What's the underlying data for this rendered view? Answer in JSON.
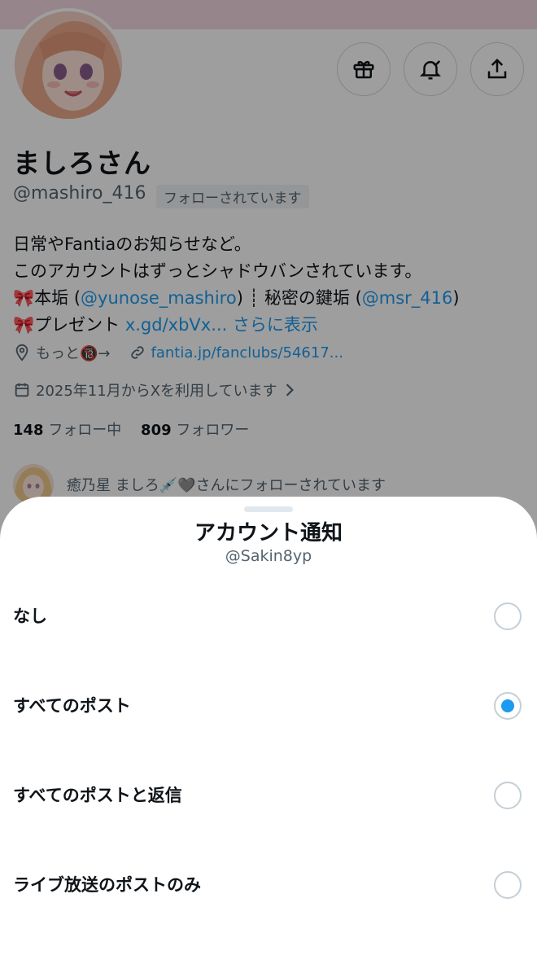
{
  "profile": {
    "name": "ましろさん",
    "handle": "@mashiro_416",
    "follows_you": "フォローされています",
    "bio": {
      "line1": "日常やFantiaのお知らせなど。",
      "line2": "このアカウントはずっとシャドウバンされています。",
      "line3_prefix": "🎀本垢 (",
      "line3_link1": "@yunose_mashiro",
      "line3_mid": ") ┊ 秘密の鍵垢 (",
      "line3_link2": "@msr_416",
      "line3_suffix": ")",
      "line4_prefix": "🎀プレゼント ",
      "line4_link": "x.gd/xbVx...",
      "line4_more": "さらに表示"
    },
    "location": "もっと🔞→",
    "website": "fantia.jp/fanclubs/54617...",
    "joined": "2025年11月からXを利用しています",
    "following_count": "148",
    "following_label": "フォロー中",
    "followers_count": "809",
    "followers_label": "フォロワー",
    "mutual_text": "癒乃星 ましろ💉🩶さんにフォローされています"
  },
  "header_actions": {
    "gift_icon": "gift-icon",
    "bell_icon": "notification-bell-icon",
    "share_icon": "share-icon"
  },
  "sheet": {
    "title": "アカウント通知",
    "subtitle": "@Sakin8yp",
    "options": [
      {
        "label": "なし",
        "selected": false
      },
      {
        "label": "すべてのポスト",
        "selected": true
      },
      {
        "label": "すべてのポストと返信",
        "selected": false
      },
      {
        "label": "ライブ放送のポストのみ",
        "selected": false
      }
    ]
  },
  "colors": {
    "accent": "#1d9bf0",
    "banner": "#f3d7df",
    "secondary_text": "#536471"
  }
}
